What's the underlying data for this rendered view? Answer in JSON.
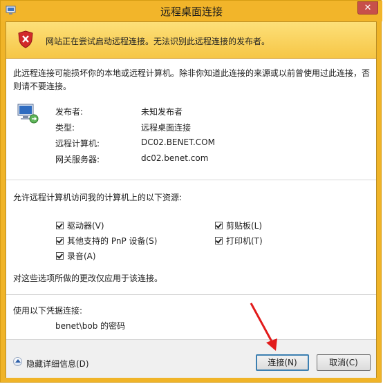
{
  "window": {
    "title": "远程桌面连接",
    "close_glyph": "✕"
  },
  "warning": {
    "text": "网站正在尝试启动远程连接。无法识别此远程连接的发布者。"
  },
  "description": "此远程连接可能损坏你的本地或远程计算机。除非你知道此连接的来源或以前曾使用过此连接，否则请不要连接。",
  "details": [
    {
      "label": "发布者:",
      "value": "未知发布者"
    },
    {
      "label": "类型:",
      "value": "远程桌面连接"
    },
    {
      "label": "远程计算机:",
      "value": "DC02.BENET.COM"
    },
    {
      "label": "网关服务器:",
      "value": "dc02.benet.com"
    }
  ],
  "resources": {
    "title": "允许远程计算机访问我的计算机上的以下资源:",
    "items": [
      {
        "label": "驱动器(V)",
        "checked": true
      },
      {
        "label": "剪贴板(L)",
        "checked": true
      },
      {
        "label": "其他支持的 PnP 设备(S)",
        "checked": true
      },
      {
        "label": "打印机(T)",
        "checked": true
      },
      {
        "label": "录音(A)",
        "checked": true
      }
    ],
    "note": "对这些选项所做的更改仅应用于该连接。"
  },
  "credentials": {
    "title": "使用以下凭据连接:",
    "user": "benet\\bob 的密码"
  },
  "footer": {
    "toggle_label": "隐藏详细信息(D)",
    "connect_label": "连接(N)",
    "cancel_label": "取消(C)"
  },
  "icons": {
    "app": "remote-desktop-icon",
    "warning": "shield-error-icon",
    "publisher": "remote-computer-icon",
    "toggle": "chevron-up-icon"
  },
  "colors": {
    "title_bar": "#f2b52a",
    "warning_band": "#f6c646",
    "accent_arrow": "#e21b1b",
    "button_focus": "#3c7fb1"
  }
}
